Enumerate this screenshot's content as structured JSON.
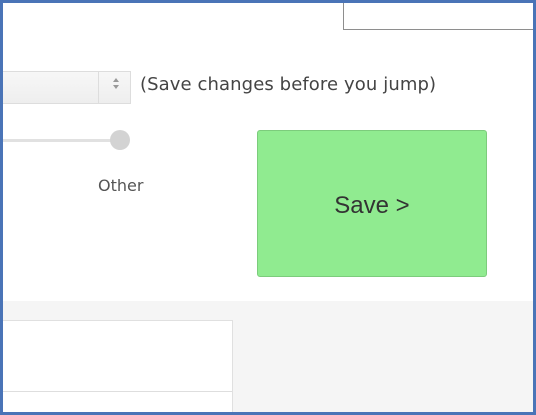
{
  "header": {
    "top_input_value": ""
  },
  "navigation": {
    "jump_select": {
      "selected_value": "",
      "icon": "sort-icon"
    },
    "save_note": "(Save changes before you jump)"
  },
  "slider": {
    "label": "Other"
  },
  "actions": {
    "save_label": "Save >"
  },
  "colors": {
    "frame_border": "#4a74b7",
    "save_button_background": "#90eb90",
    "page_background": "#ffffff",
    "section_background": "#f5f5f5",
    "slider_knob": "#d3d3d3"
  }
}
